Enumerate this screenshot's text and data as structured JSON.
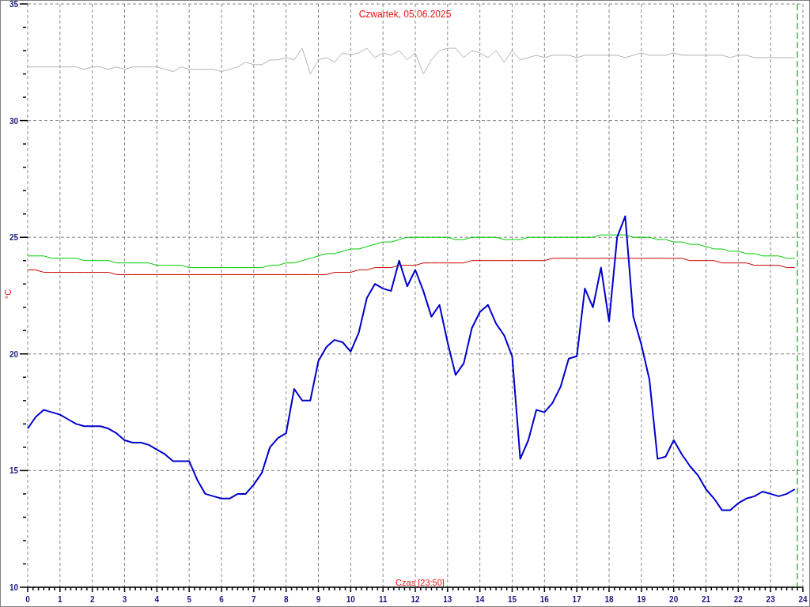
{
  "chart": {
    "chart_data": {
      "type": "line",
      "title": "Czwartek, 05.06.2025",
      "xlabel": "Czas [23:50]",
      "ylabel": "°C",
      "x": [
        0,
        0.25,
        0.5,
        0.75,
        1,
        1.25,
        1.5,
        1.75,
        2,
        2.25,
        2.5,
        2.75,
        3,
        3.25,
        3.5,
        3.75,
        4,
        4.25,
        4.5,
        4.75,
        5,
        5.25,
        5.5,
        5.75,
        6,
        6.25,
        6.5,
        6.75,
        7,
        7.25,
        7.5,
        7.75,
        8,
        8.25,
        8.5,
        8.75,
        9,
        9.25,
        9.5,
        9.75,
        10,
        10.25,
        10.5,
        10.75,
        11,
        11.25,
        11.5,
        11.75,
        12,
        12.25,
        12.5,
        12.75,
        13,
        13.25,
        13.5,
        13.75,
        14,
        14.25,
        14.5,
        14.75,
        15,
        15.25,
        15.5,
        15.75,
        16,
        16.25,
        16.5,
        16.75,
        17,
        17.25,
        17.5,
        17.75,
        18,
        18.25,
        18.5,
        18.75,
        19,
        19.25,
        19.5,
        19.75,
        20,
        20.25,
        20.5,
        20.75,
        21,
        21.25,
        21.5,
        21.75,
        22,
        22.25,
        22.5,
        22.75,
        23,
        23.25,
        23.5,
        23.75
      ],
      "series": [
        {
          "color": "#b4b4b4",
          "values": [
            32.3,
            32.3,
            32.3,
            32.3,
            32.3,
            32.3,
            32.3,
            32.2,
            32.3,
            32.3,
            32.2,
            32.3,
            32.2,
            32.3,
            32.3,
            32.3,
            32.3,
            32.2,
            32.1,
            32.3,
            32.2,
            32.2,
            32.2,
            32.2,
            32.1,
            32.2,
            32.3,
            32.5,
            32.4,
            32.4,
            32.6,
            32.6,
            32.7,
            32.6,
            33.1,
            32.0,
            32.6,
            32.7,
            32.5,
            32.9,
            32.8,
            32.9,
            33.1,
            32.7,
            32.9,
            32.8,
            33.0,
            32.6,
            32.9,
            32.0,
            32.6,
            33.0,
            33.1,
            33.1,
            32.7,
            33.0,
            32.9,
            32.7,
            33.0,
            32.5,
            33.0,
            32.6,
            32.7,
            32.8,
            32.7,
            32.8,
            32.8,
            32.8,
            32.7,
            32.8,
            32.8,
            32.8,
            32.8,
            32.8,
            32.7,
            32.8,
            32.9,
            32.8,
            32.8,
            32.8,
            32.9,
            32.8,
            32.8,
            32.8,
            32.8,
            32.8,
            32.8,
            32.7,
            32.8,
            32.8,
            32.7,
            32.7,
            32.7,
            32.7,
            32.7,
            32.7
          ]
        },
        {
          "color": "#00cc00",
          "values": [
            24.2,
            24.2,
            24.2,
            24.1,
            24.1,
            24.1,
            24.1,
            24.0,
            24.0,
            24.0,
            24.0,
            23.9,
            23.9,
            23.9,
            23.9,
            23.9,
            23.8,
            23.8,
            23.8,
            23.8,
            23.7,
            23.7,
            23.7,
            23.7,
            23.7,
            23.7,
            23.7,
            23.7,
            23.7,
            23.7,
            23.8,
            23.8,
            23.9,
            23.9,
            24.0,
            24.1,
            24.2,
            24.3,
            24.3,
            24.4,
            24.5,
            24.5,
            24.6,
            24.7,
            24.8,
            24.8,
            24.9,
            25.0,
            25.0,
            25.0,
            25.0,
            25.0,
            25.0,
            24.9,
            24.9,
            25.0,
            25.0,
            25.0,
            25.0,
            24.9,
            24.9,
            24.9,
            25.0,
            25.0,
            25.0,
            25.0,
            25.0,
            25.0,
            25.0,
            25.0,
            25.0,
            25.1,
            25.1,
            25.1,
            25.1,
            25.0,
            25.0,
            25.0,
            24.9,
            24.9,
            24.8,
            24.8,
            24.7,
            24.7,
            24.6,
            24.5,
            24.5,
            24.4,
            24.4,
            24.3,
            24.3,
            24.2,
            24.2,
            24.2,
            24.1,
            24.1
          ]
        },
        {
          "color": "#cc0000",
          "values": [
            23.6,
            23.6,
            23.5,
            23.5,
            23.5,
            23.5,
            23.5,
            23.5,
            23.5,
            23.5,
            23.5,
            23.4,
            23.4,
            23.4,
            23.4,
            23.4,
            23.4,
            23.4,
            23.4,
            23.4,
            23.4,
            23.4,
            23.4,
            23.4,
            23.4,
            23.4,
            23.4,
            23.4,
            23.4,
            23.4,
            23.4,
            23.4,
            23.4,
            23.4,
            23.4,
            23.4,
            23.4,
            23.4,
            23.5,
            23.5,
            23.5,
            23.6,
            23.6,
            23.7,
            23.7,
            23.7,
            23.8,
            23.8,
            23.8,
            23.9,
            23.9,
            23.9,
            23.9,
            23.9,
            23.9,
            24.0,
            24.0,
            24.0,
            24.0,
            24.0,
            24.0,
            24.0,
            24.0,
            24.0,
            24.0,
            24.1,
            24.1,
            24.1,
            24.1,
            24.1,
            24.1,
            24.1,
            24.1,
            24.1,
            24.1,
            24.1,
            24.1,
            24.1,
            24.1,
            24.1,
            24.1,
            24.1,
            24.0,
            24.0,
            24.0,
            24.0,
            23.9,
            23.9,
            23.9,
            23.9,
            23.8,
            23.8,
            23.8,
            23.8,
            23.7,
            23.7
          ]
        },
        {
          "color": "#0000cc",
          "values": [
            16.8,
            17.3,
            17.6,
            17.5,
            17.4,
            17.2,
            17.0,
            16.9,
            16.9,
            16.9,
            16.8,
            16.6,
            16.3,
            16.2,
            16.2,
            16.1,
            15.9,
            15.7,
            15.4,
            15.4,
            15.4,
            14.6,
            14.0,
            13.9,
            13.8,
            13.8,
            14.0,
            14.0,
            14.4,
            14.9,
            16.0,
            16.4,
            16.6,
            18.5,
            18.0,
            18.0,
            19.7,
            20.3,
            20.6,
            20.5,
            20.1,
            20.9,
            22.4,
            23.0,
            22.8,
            22.7,
            24.0,
            22.9,
            23.6,
            22.7,
            21.6,
            22.1,
            20.5,
            19.1,
            19.6,
            21.1,
            21.8,
            22.1,
            21.3,
            20.8,
            19.9,
            15.5,
            16.3,
            17.6,
            17.5,
            17.9,
            18.6,
            19.8,
            19.9,
            22.8,
            22.0,
            23.7,
            21.4,
            25.0,
            25.9,
            21.6,
            20.4,
            18.9,
            15.5,
            15.6,
            16.3,
            15.7,
            15.2,
            14.8,
            14.2,
            13.8,
            13.3,
            13.3,
            13.6,
            13.8,
            13.9,
            14.1,
            14.0,
            13.9,
            14.0,
            14.2
          ]
        }
      ],
      "xlim": [
        0,
        24
      ],
      "ylim": [
        10,
        35
      ],
      "xticks": [
        0,
        1,
        2,
        3,
        4,
        5,
        6,
        7,
        8,
        9,
        10,
        11,
        12,
        13,
        14,
        15,
        16,
        17,
        18,
        19,
        20,
        21,
        22,
        23,
        24
      ],
      "yticks": [
        10,
        15,
        20,
        25,
        30,
        35
      ],
      "grid": true,
      "ref_lines": [
        {
          "axis": "x",
          "value": 23.83,
          "color": "#008800"
        }
      ]
    }
  }
}
